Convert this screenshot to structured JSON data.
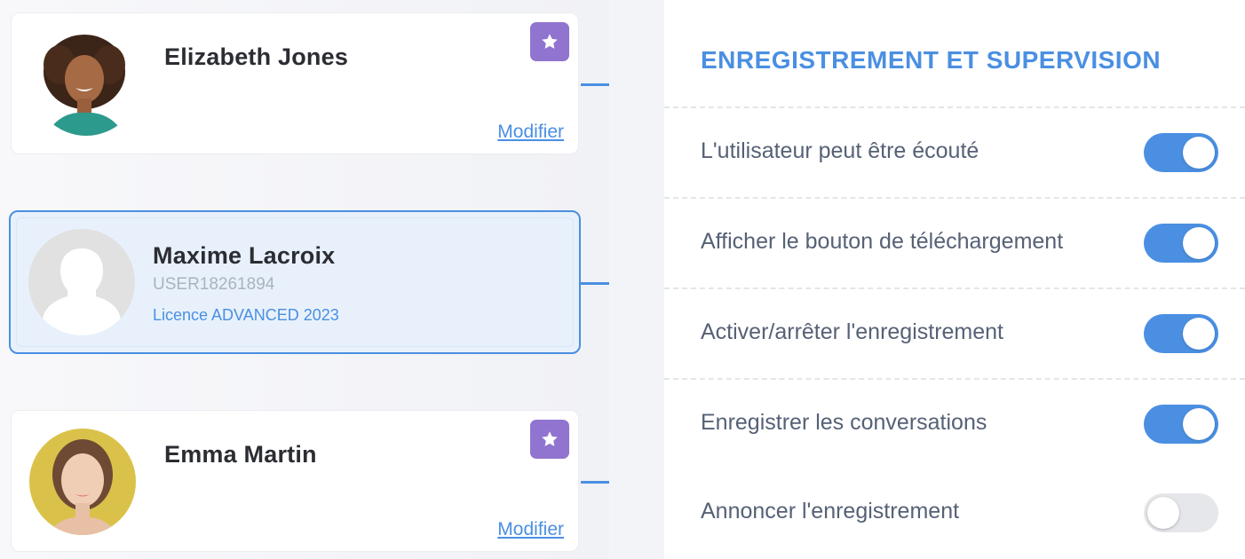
{
  "users": [
    {
      "name": "Elizabeth Jones",
      "favorite": true,
      "edit_label": "Modifier",
      "avatar": "photo-woman-curly-hair"
    },
    {
      "name": "Maxime Lacroix",
      "user_id": "USER18261894",
      "licence": "Licence ADVANCED 2023",
      "selected": true,
      "avatar": "default-silhouette"
    },
    {
      "name": "Emma Martin",
      "favorite": true,
      "edit_label": "Modifier",
      "avatar": "photo-woman-yellow-background"
    }
  ],
  "settings": {
    "title": "ENREGISTREMENT ET SUPERVISION",
    "options": [
      {
        "label": "L'utilisateur peut être écouté",
        "enabled": true
      },
      {
        "label": "Afficher le bouton de téléchargement",
        "enabled": true
      },
      {
        "label": "Activer/arrêter l'enregistrement",
        "enabled": true
      },
      {
        "label": "Enregistrer les conversations",
        "enabled": true
      },
      {
        "label": "Annoncer l'enregistrement",
        "enabled": false
      }
    ]
  },
  "colors": {
    "accent": "#4a8fe2",
    "favorite_badge": "#9174cf",
    "toggle_off": "#e6e7ea"
  },
  "icons": {
    "favorite": "star-icon"
  }
}
